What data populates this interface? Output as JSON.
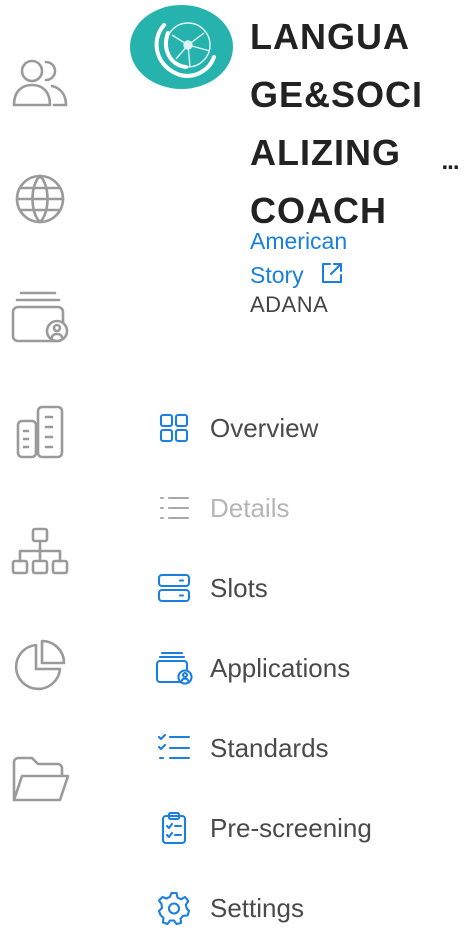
{
  "org": {
    "title": "LANGUAGE&SOCIALIZING COACH",
    "link_label": "American Story",
    "city": "ADANA",
    "more_label": "..."
  },
  "rail": {
    "icons": [
      "users-icon",
      "globe-icon",
      "wallet-user-icon",
      "buildings-icon",
      "org-chart-icon",
      "pie-chart-icon",
      "folder-icon"
    ]
  },
  "menu": {
    "items": [
      {
        "label": "Overview",
        "icon": "grid-icon",
        "state": "default"
      },
      {
        "label": "Details",
        "icon": "list-icon",
        "state": "disabled"
      },
      {
        "label": "Slots",
        "icon": "server-icon",
        "state": "default"
      },
      {
        "label": "Applications",
        "icon": "wallet-user-icon",
        "state": "default"
      },
      {
        "label": "Standards",
        "icon": "checklist-icon",
        "state": "default"
      },
      {
        "label": "Pre-screening",
        "icon": "clipboard-check-icon",
        "state": "default"
      },
      {
        "label": "Settings",
        "icon": "gear-icon",
        "state": "default"
      }
    ]
  },
  "colors": {
    "accent": "#1a7fe0",
    "logo_bg": "#27b3ad",
    "rail_icon": "#9a9a9a",
    "disabled": "#b5b5b5",
    "text": "#4a4a4a",
    "title": "#222222"
  }
}
